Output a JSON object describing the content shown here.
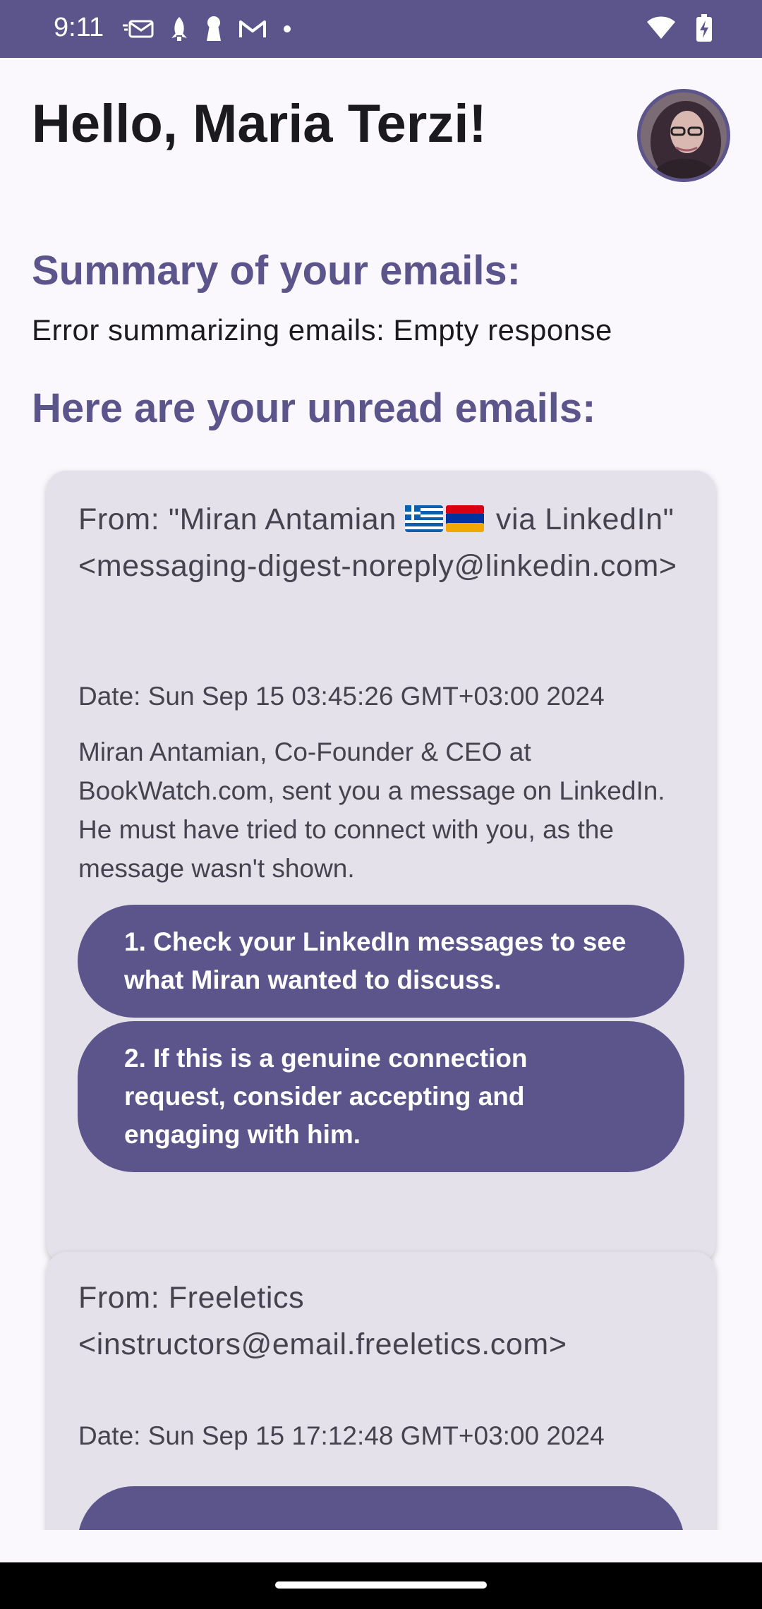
{
  "status_bar": {
    "time": "9:11",
    "left_icons": [
      "message-icon",
      "rocket-icon",
      "keyhole-icon",
      "gmail-icon",
      "dot-icon"
    ],
    "right_icons": [
      "wifi-icon",
      "battery-charging-icon"
    ]
  },
  "header": {
    "greeting": "Hello, Maria Terzi!"
  },
  "summary": {
    "title": "Summary of your emails:",
    "text": "Error summarizing emails: Empty response"
  },
  "unread": {
    "title": "Here are your unread emails:"
  },
  "emails": [
    {
      "from_prefix": "From: \"Miran Antamian ",
      "from_suffix": " via LinkedIn\" <messaging-digest-noreply@linkedin.com>",
      "flags": [
        "greece-flag-icon",
        "armenia-flag-icon"
      ],
      "date": "Date: Sun Sep 15 03:45:26 GMT+03:00 2024",
      "body": "Miran Antamian, Co-Founder & CEO at BookWatch.com, sent you a message on LinkedIn. He must have tried to connect with you, as the message wasn't shown.",
      "actions": [
        "1. Check your LinkedIn messages to see what Miran wanted to discuss.",
        "2. If this is a genuine connection request, consider accepting and engaging with him."
      ]
    },
    {
      "from": "From: Freeletics <instructors@email.freeletics.com>",
      "date": "Date: Sun Sep 15 17:12:48 GMT+03:00 2024"
    }
  ],
  "colors": {
    "primary": "#5c558b",
    "card": "#e4e1ea",
    "background": "#fbf8fd"
  }
}
